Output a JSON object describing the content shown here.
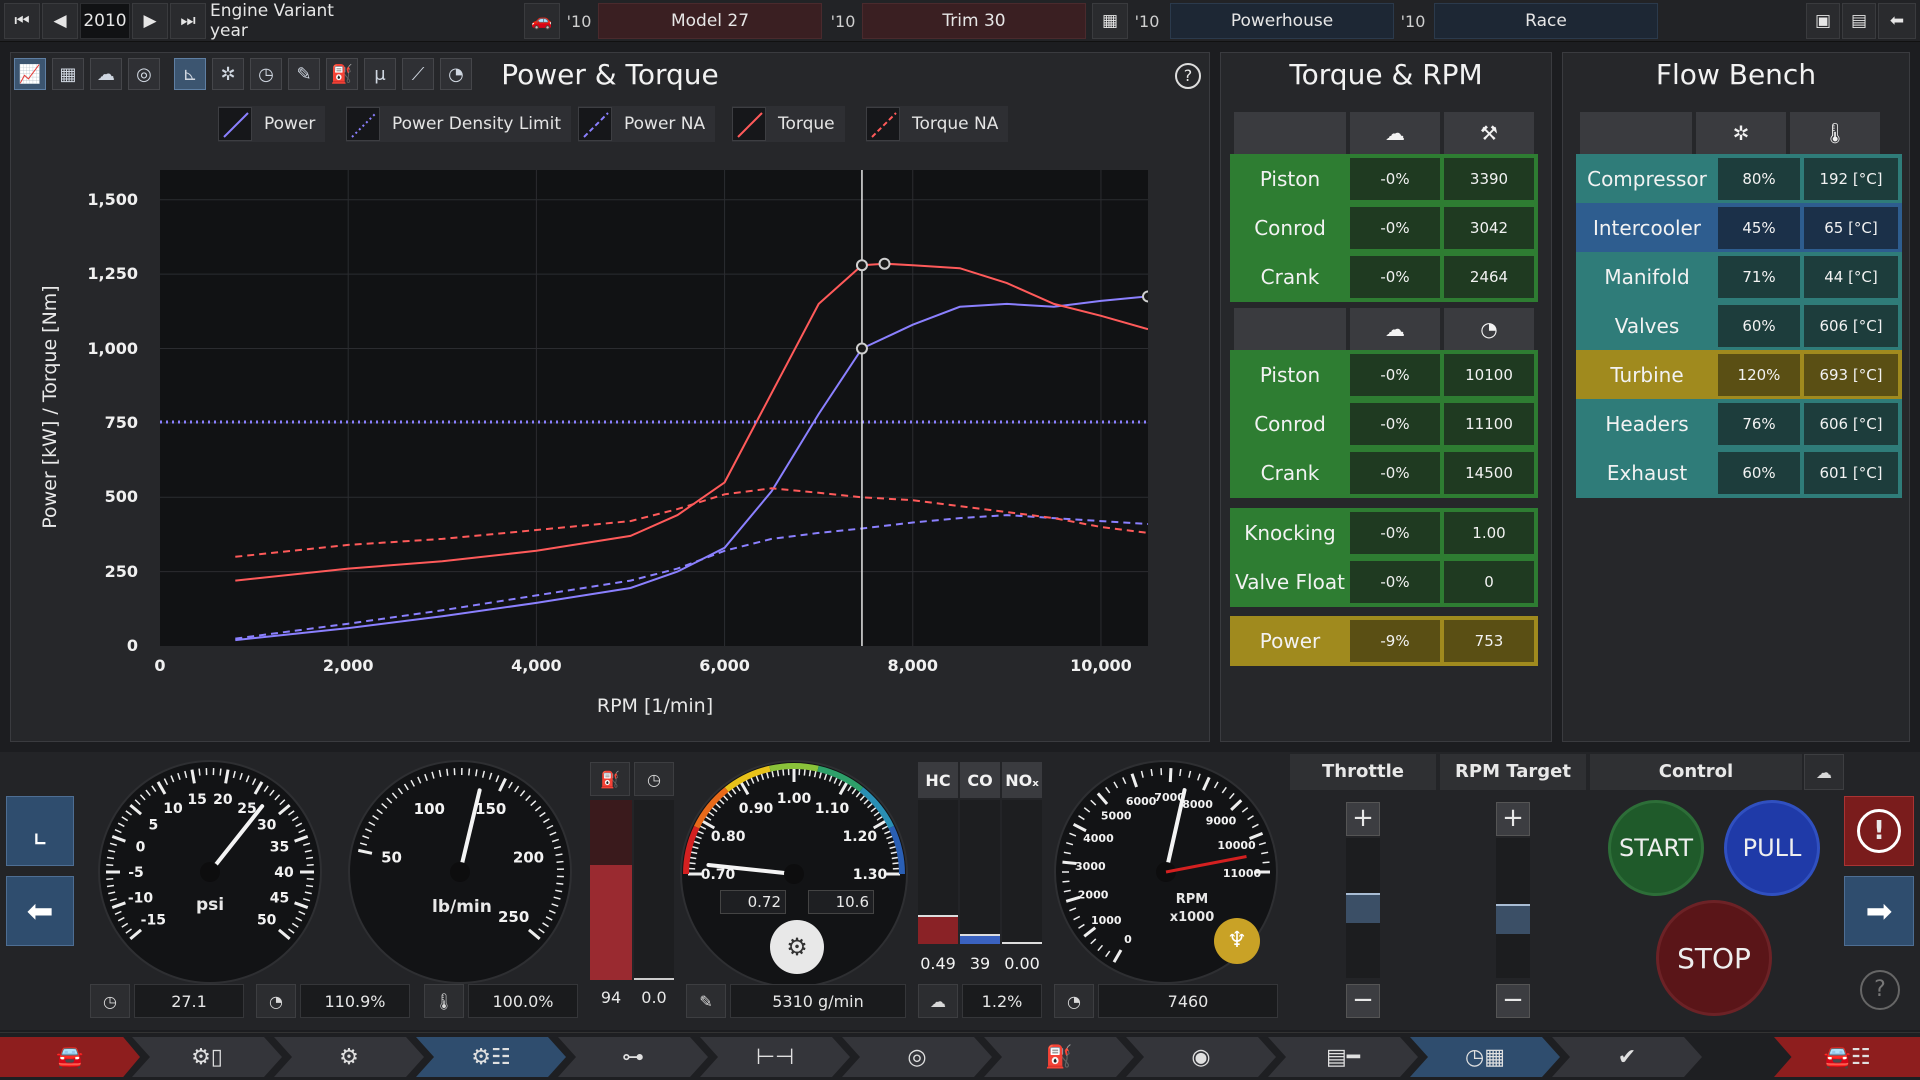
{
  "topbar": {
    "year": "2010",
    "variant": "Engine Variant year",
    "y1": "'10",
    "model": "Model 27",
    "y2": "'10",
    "trim": "Trim 30",
    "y3": "'10",
    "powerhouse": "Powerhouse",
    "y4": "'10",
    "race": "Race"
  },
  "main": {
    "title": "Power & Torque",
    "help": "?",
    "legend": [
      {
        "label": "Power",
        "color": "#8b80ff"
      },
      {
        "label": "Power Density Limit",
        "color": "#8b80ff"
      },
      {
        "label": "Power NA",
        "color": "#8b80ff"
      },
      {
        "label": "Torque",
        "color": "#ff5a5a"
      },
      {
        "label": "Torque NA",
        "color": "#ff5a5a"
      }
    ]
  },
  "chart_data": {
    "type": "line",
    "xlabel": "RPM [1/min]",
    "ylabel": "Power [kW] / Torque [Nm]",
    "xlim": [
      0,
      10500
    ],
    "ylim": [
      0,
      1600
    ],
    "xticks": [
      "0",
      "2,000",
      "4,000",
      "6,000",
      "8,000",
      "10,000"
    ],
    "xtick_values": [
      0,
      2000,
      4000,
      6000,
      8000,
      10000
    ],
    "yticks": [
      "0",
      "250",
      "500",
      "750",
      "1,000",
      "1,250",
      "1,500"
    ],
    "ytick_values": [
      0,
      250,
      500,
      750,
      1000,
      1250,
      1500
    ],
    "cursor_rpm": 7460,
    "series": [
      {
        "name": "Power",
        "color": "#8b80ff",
        "dash": "none",
        "x": [
          800,
          2000,
          3000,
          4000,
          5000,
          5500,
          6000,
          6500,
          7000,
          7460,
          8000,
          8500,
          9000,
          9500,
          10000,
          10500
        ],
        "y": [
          20,
          60,
          100,
          145,
          195,
          250,
          330,
          520,
          780,
          1000,
          1080,
          1140,
          1150,
          1140,
          1160,
          1175
        ]
      },
      {
        "name": "Torque",
        "color": "#ff5a5a",
        "dash": "none",
        "x": [
          800,
          2000,
          3000,
          4000,
          5000,
          5500,
          6000,
          6500,
          7000,
          7460,
          7700,
          8000,
          8500,
          9000,
          9500,
          10000,
          10500
        ],
        "y": [
          220,
          260,
          285,
          320,
          370,
          440,
          550,
          850,
          1150,
          1280,
          1285,
          1280,
          1270,
          1220,
          1150,
          1110,
          1065
        ]
      },
      {
        "name": "Power NA",
        "color": "#8b80ff",
        "dash": "7,5",
        "x": [
          800,
          2000,
          3000,
          4000,
          5000,
          5500,
          6000,
          6500,
          7000,
          7460,
          8000,
          8500,
          9000,
          9500,
          10000,
          10500
        ],
        "y": [
          25,
          75,
          120,
          170,
          220,
          260,
          320,
          360,
          380,
          395,
          415,
          430,
          440,
          430,
          420,
          410
        ]
      },
      {
        "name": "Torque NA",
        "color": "#ff5a5a",
        "dash": "7,5",
        "x": [
          800,
          2000,
          3000,
          4000,
          5000,
          5500,
          6000,
          6500,
          7000,
          7460,
          8000,
          8500,
          9000,
          9500,
          10000,
          10500
        ],
        "y": [
          300,
          340,
          360,
          390,
          420,
          460,
          510,
          530,
          515,
          500,
          490,
          470,
          450,
          430,
          400,
          380
        ]
      },
      {
        "name": "Power Density Limit",
        "color": "#8b80ff",
        "dash": "2,4",
        "x": [
          0,
          10500
        ],
        "y": [
          753,
          753
        ]
      }
    ]
  },
  "torque_rpm": {
    "title": "Torque & RPM",
    "group1": [
      {
        "name": "Piston",
        "pct": "-0%",
        "val": "3390"
      },
      {
        "name": "Conrod",
        "pct": "-0%",
        "val": "3042"
      },
      {
        "name": "Crank",
        "pct": "-0%",
        "val": "2464"
      }
    ],
    "group2": [
      {
        "name": "Piston",
        "pct": "-0%",
        "val": "10100"
      },
      {
        "name": "Conrod",
        "pct": "-0%",
        "val": "11100"
      },
      {
        "name": "Crank",
        "pct": "-0%",
        "val": "14500"
      }
    ],
    "group3": [
      {
        "name": "Knocking",
        "pct": "-0%",
        "val": "1.00"
      },
      {
        "name": "Valve Float",
        "pct": "-0%",
        "val": "0"
      }
    ],
    "power": {
      "name": "Power",
      "pct": "-9%",
      "val": "753"
    }
  },
  "flow": {
    "title": "Flow Bench",
    "rows": [
      {
        "name": "Compressor",
        "pct": "80%",
        "temp": "192 [°C]",
        "c": "tl"
      },
      {
        "name": "Intercooler",
        "pct": "45%",
        "temp": "65 [°C]",
        "c": "bl"
      },
      {
        "name": "Manifold",
        "pct": "71%",
        "temp": "44 [°C]",
        "c": "tl"
      },
      {
        "name": "Valves",
        "pct": "60%",
        "temp": "606 [°C]",
        "c": "tl"
      },
      {
        "name": "Turbine",
        "pct": "120%",
        "temp": "693 [°C]",
        "c": "ylw"
      },
      {
        "name": "Headers",
        "pct": "76%",
        "temp": "606 [°C]",
        "c": "tl"
      },
      {
        "name": "Exhaust",
        "pct": "60%",
        "temp": "601 [°C]",
        "c": "tl"
      }
    ]
  },
  "gauges": {
    "boost": {
      "unit": "psi",
      "ticks": [
        "-15",
        "-10",
        "-5",
        "0",
        "5",
        "10",
        "15",
        "20",
        "25",
        "30",
        "35",
        "40",
        "45",
        "50"
      ],
      "readout": "27.1",
      "value": 27.1,
      "min": -15,
      "max": 50
    },
    "flow": {
      "unit": "lb/min",
      "ticks": [
        "50",
        "100",
        "150",
        "200",
        "250"
      ],
      "readout": "110.9%",
      "value": 110,
      "min": 0,
      "max": 250
    },
    "temp_readout": "100.0%",
    "fuel": {
      "left": "94",
      "right": "0.0",
      "level": 0.64
    },
    "lambda": {
      "ticks": [
        "0.70",
        "0.80",
        "0.90",
        "1.00",
        "1.10",
        "1.20",
        "1.30"
      ],
      "value": 0.72,
      "min": 0.7,
      "max": 1.3,
      "sub1": "0.72",
      "sub2": "10.6",
      "airflow": "5310 g/min"
    },
    "emissions": {
      "labels": [
        "HC",
        "CO",
        "NOₓ"
      ],
      "values": [
        "0.49",
        "39",
        "0.00"
      ],
      "levels": [
        0.2,
        0.07,
        0.0
      ],
      "bottom": "1.2%"
    },
    "rpm": {
      "unit": "RPM",
      "scale": "x1000",
      "ticks": [
        "0",
        "1000",
        "2000",
        "3000",
        "4000",
        "5000",
        "6000",
        "7000",
        "8000",
        "9000",
        "10000",
        "11000"
      ],
      "value": 7460,
      "redline": 10500,
      "readout": "7460"
    }
  },
  "controls": {
    "throttle": "Throttle",
    "rpm_target": "RPM Target",
    "control": "Control",
    "plus": "+",
    "minus": "−",
    "start": "START",
    "pull": "PULL",
    "stop": "STOP",
    "throttle_level": 0.5,
    "rpm_level": 0.4,
    "help": "?",
    "warn": "!"
  }
}
